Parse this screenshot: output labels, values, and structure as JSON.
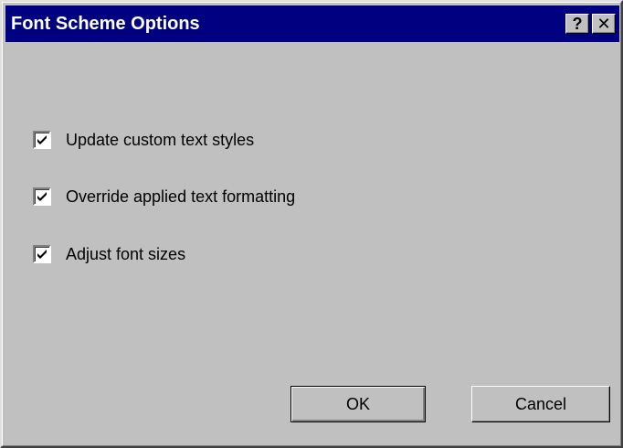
{
  "dialog": {
    "title": "Font Scheme Options",
    "help_button": "?",
    "close_button": "✕",
    "options": [
      {
        "label": "Update custom text styles",
        "checked": true
      },
      {
        "label": "Override applied text formatting",
        "checked": true
      },
      {
        "label": "Adjust font sizes",
        "checked": true
      }
    ],
    "ok_label": "OK",
    "cancel_label": "Cancel"
  },
  "colors": {
    "titlebar": "#000080",
    "face": "#c0c0c0"
  }
}
